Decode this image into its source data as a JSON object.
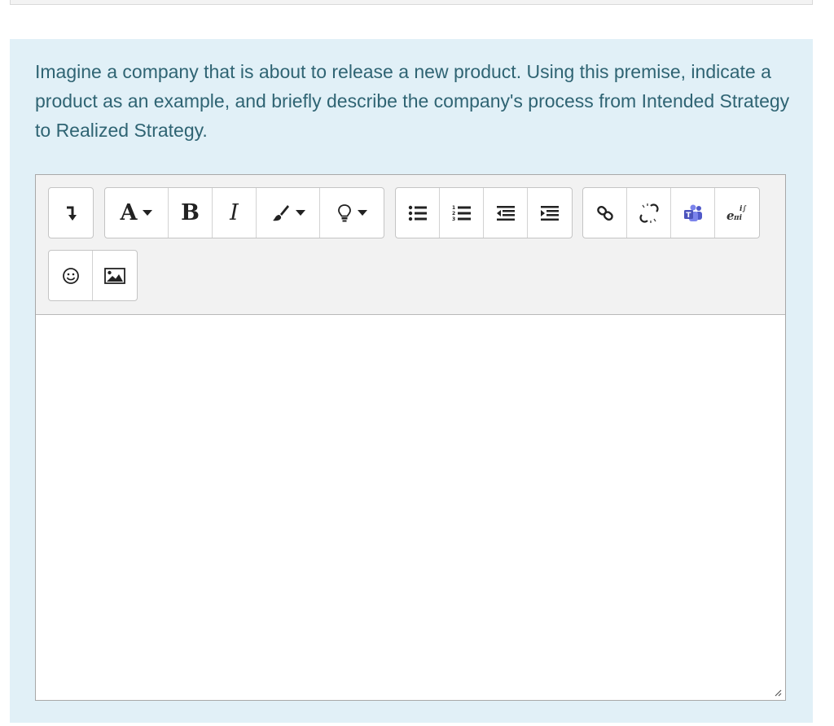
{
  "question": {
    "text": "Imagine a company that is about to release a new product. Using this premise, indicate a product as an example, and briefly describe the company's process from Intended Strategy to Realized Strategy."
  },
  "toolbar": {
    "groups": [
      {
        "name": "collapse",
        "buttons": [
          "toggle-toolbar-icon"
        ]
      },
      {
        "name": "style",
        "buttons": [
          "paragraph-styles-icon",
          "bold-icon",
          "italic-icon",
          "font-color-icon",
          "accessibility-helper-icon"
        ]
      },
      {
        "name": "list",
        "buttons": [
          "unordered-list-icon",
          "ordered-list-icon",
          "outdent-icon",
          "indent-icon"
        ]
      },
      {
        "name": "links",
        "buttons": [
          "link-icon",
          "unlink-icon",
          "teams-meeting-icon",
          "equation-icon"
        ]
      },
      {
        "name": "files",
        "buttons": [
          "emoji-icon",
          "image-icon"
        ]
      }
    ],
    "labels": {
      "style_a": "A",
      "bold": "B",
      "italic": "I"
    }
  },
  "editor": {
    "value": ""
  },
  "colors": {
    "panel_bg": "#e1f0f7",
    "question_text": "#2f6473",
    "toolbar_bg": "#f2f2f2"
  }
}
